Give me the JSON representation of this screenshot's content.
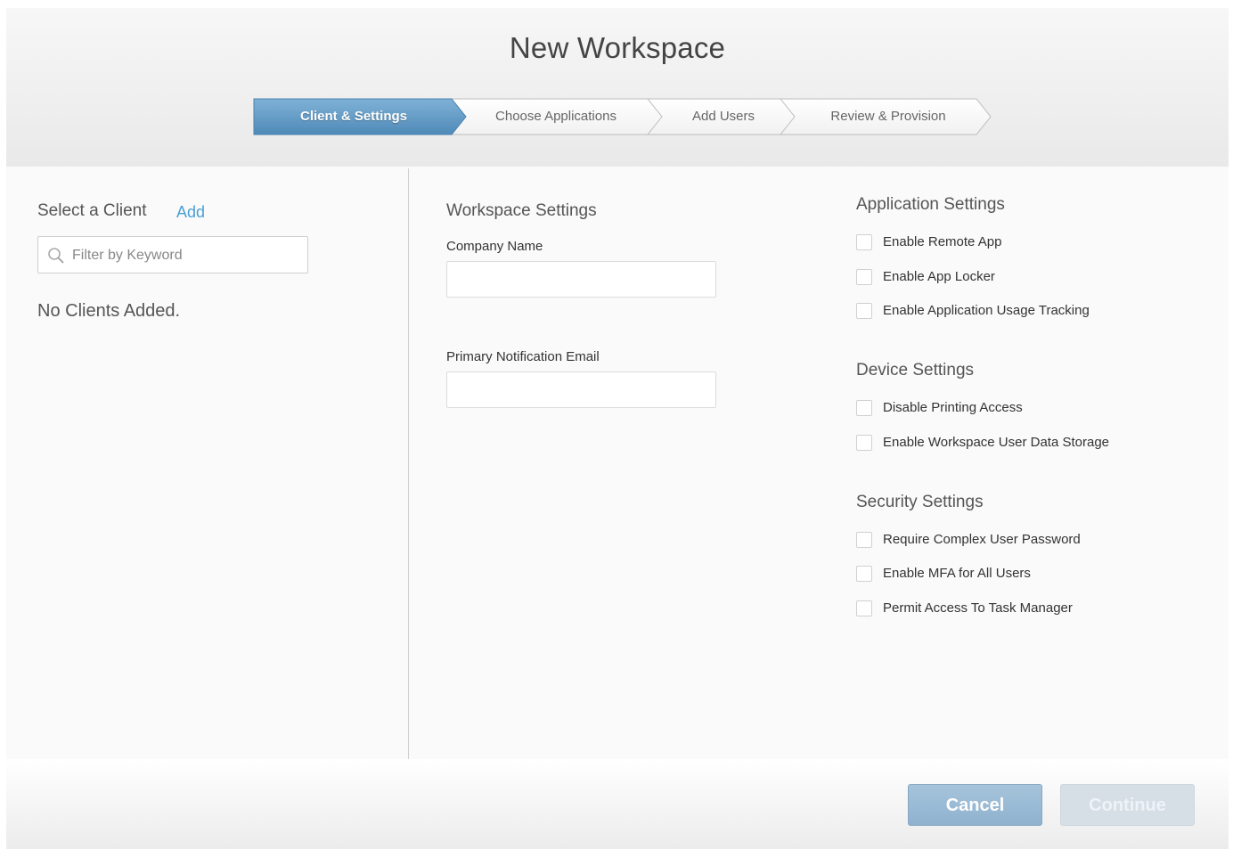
{
  "dialog": {
    "title": "New Workspace",
    "steps": [
      {
        "label": "Client & Settings",
        "active": true
      },
      {
        "label": "Choose Applications",
        "active": false
      },
      {
        "label": "Add Users",
        "active": false
      },
      {
        "label": "Review & Provision",
        "active": false
      }
    ]
  },
  "client_panel": {
    "title": "Select a Client",
    "add_label": "Add",
    "filter_placeholder": "Filter by Keyword",
    "empty_message": "No Clients Added."
  },
  "workspace_settings": {
    "title": "Workspace Settings",
    "company_name_label": "Company Name",
    "company_name_value": "",
    "email_label": "Primary Notification Email",
    "email_value": ""
  },
  "application_settings": {
    "title": "Application Settings",
    "options": [
      {
        "label": "Enable Remote App",
        "checked": false
      },
      {
        "label": "Enable App Locker",
        "checked": false
      },
      {
        "label": "Enable Application Usage Tracking",
        "checked": false
      }
    ]
  },
  "device_settings": {
    "title": "Device Settings",
    "options": [
      {
        "label": "Disable Printing Access",
        "checked": false
      },
      {
        "label": "Enable Workspace User Data Storage",
        "checked": false
      }
    ]
  },
  "security_settings": {
    "title": "Security Settings",
    "options": [
      {
        "label": "Require Complex User Password",
        "checked": false
      },
      {
        "label": "Enable MFA for All Users",
        "checked": false
      },
      {
        "label": "Permit Access To Task Manager",
        "checked": false
      }
    ]
  },
  "footer": {
    "cancel_label": "Cancel",
    "continue_label": "Continue"
  },
  "colors": {
    "active_step": "#5b97c3",
    "link": "#4a9fd6",
    "cancel_button": "#9dbdd6",
    "continue_disabled": "#d6dfe6"
  }
}
